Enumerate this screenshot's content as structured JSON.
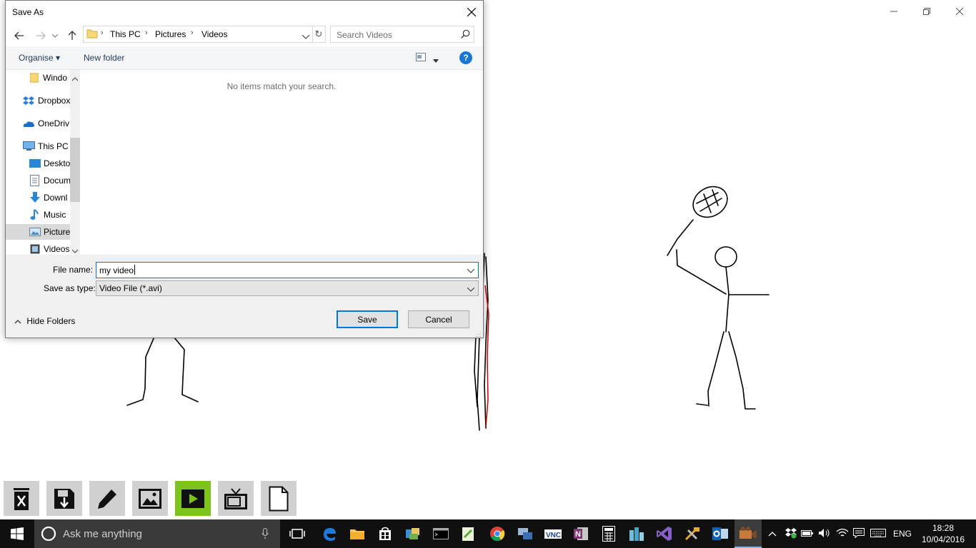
{
  "dialog": {
    "title": "Save As",
    "breadcrumb": [
      "This PC",
      "Pictures",
      "Videos"
    ],
    "search_placeholder": "Search Videos",
    "toolbar": {
      "organise": "Organise",
      "new_folder": "New folder",
      "help": "?"
    },
    "nav_items": [
      {
        "label": "Windo",
        "icon": "folder-icon"
      },
      {
        "label": "Dropbox",
        "icon": "dropbox-icon"
      },
      {
        "label": "OneDriv",
        "icon": "onedrive-icon"
      },
      {
        "label": "This PC",
        "icon": "computer-icon"
      },
      {
        "label": "Deskto",
        "icon": "desktop-icon"
      },
      {
        "label": "Docum",
        "icon": "documents-icon"
      },
      {
        "label": "Downl",
        "icon": "downloads-icon"
      },
      {
        "label": "Music",
        "icon": "music-icon"
      },
      {
        "label": "Picture",
        "icon": "pictures-icon",
        "selected": true
      },
      {
        "label": "Videos",
        "icon": "videos-icon"
      }
    ],
    "empty_message": "No items match your search.",
    "file_name_label": "File name:",
    "file_name_value": "my video",
    "save_type_label": "Save as type:",
    "save_type_value": "Video File (*.avi)",
    "save_button": "Save",
    "cancel_button": "Cancel",
    "hide_folders": "Hide Folders"
  },
  "app_toolbar": [
    {
      "name": "delete-button",
      "icon": "trash-icon"
    },
    {
      "name": "save-button",
      "icon": "floppy-icon"
    },
    {
      "name": "pen-button",
      "icon": "pencil-icon"
    },
    {
      "name": "image-button",
      "icon": "picture-icon"
    },
    {
      "name": "play-button",
      "icon": "play-icon",
      "active": true
    },
    {
      "name": "tv-button",
      "icon": "tv-icon"
    },
    {
      "name": "new-page-button",
      "icon": "page-icon"
    }
  ],
  "taskbar": {
    "search_text": "Ask me anything",
    "language": "ENG",
    "time": "18:28",
    "date": "10/04/2016",
    "pinned": [
      "task-view-icon",
      "edge-icon",
      "file-explorer-icon",
      "store-icon",
      "network-app-icon",
      "cmd-icon",
      "notepad-plus-icon",
      "chrome-icon",
      "remote-desktop-icon",
      "vnc-icon",
      "onenote-icon",
      "calculator-icon",
      "city-app-icon",
      "visual-studio-icon",
      "tools-icon",
      "outlook-icon",
      "video-recorder-icon"
    ]
  },
  "colors": {
    "accent": "#0078d7",
    "active_app_button": "#7ec31c",
    "taskbar": "#101010"
  }
}
